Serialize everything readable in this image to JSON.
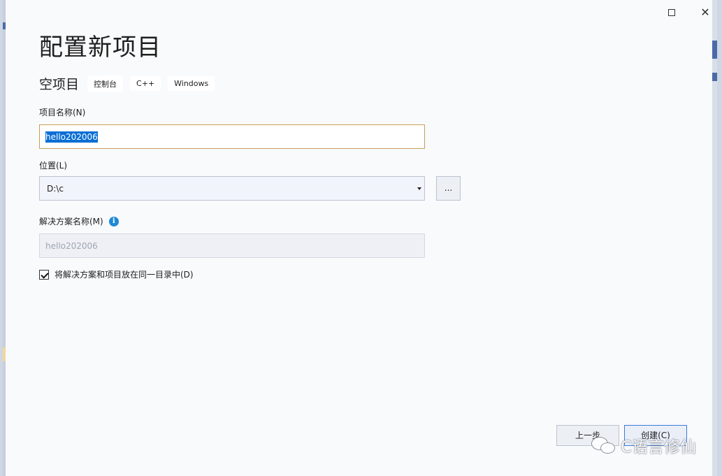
{
  "window": {
    "title": "配置新项目",
    "controls": {
      "maximize_icon": "maximize-icon",
      "close_glyph": "✕"
    }
  },
  "template": {
    "name": "空项目",
    "tags": [
      "控制台",
      "C++",
      "Windows"
    ]
  },
  "form": {
    "project_name": {
      "label": "项目名称(N)",
      "value": "hello202006"
    },
    "location": {
      "label": "位置(L)",
      "value": "D:\\c",
      "browse_label": "..."
    },
    "solution_name": {
      "label": "解决方案名称(M)",
      "value": "hello202006",
      "info_glyph": "i"
    },
    "same_directory": {
      "label": "将解决方案和项目放在同一目录中(D)",
      "checked": true
    }
  },
  "buttons": {
    "back_label": "上一步",
    "create_label": "创建(C)"
  },
  "watermark": {
    "text": "C语言修仙"
  },
  "colors": {
    "accent": "#0a6fd6",
    "focus_border": "#c7a058",
    "info": "#1f8ad6",
    "primary_button_border": "#3d7bd9"
  }
}
